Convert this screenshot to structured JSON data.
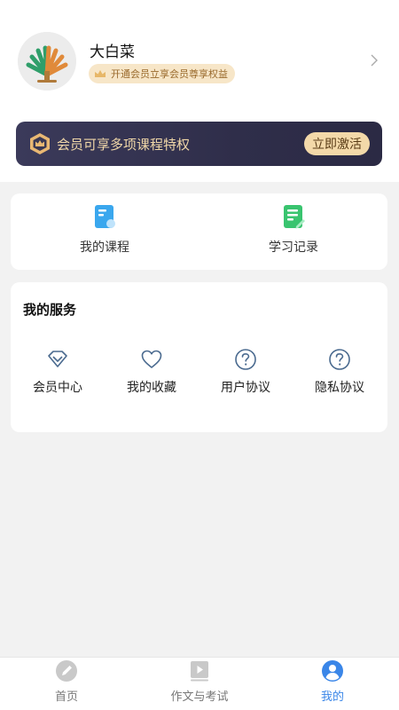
{
  "profile": {
    "username": "大白菜",
    "vip_pill_text": "开通会员立享会员尊享权益"
  },
  "banner": {
    "text": "会员可享多项课程特权",
    "button_label": "立即激活"
  },
  "quick": {
    "items": [
      {
        "label": "我的课程",
        "icon": "book-icon",
        "color": "#3aa7ee"
      },
      {
        "label": "学习记录",
        "icon": "note-icon",
        "color": "#39c46f"
      }
    ]
  },
  "services": {
    "title": "我的服务",
    "items": [
      {
        "label": "会员中心",
        "icon": "diamond-icon"
      },
      {
        "label": "我的收藏",
        "icon": "heart-icon"
      },
      {
        "label": "用户协议",
        "icon": "question-icon"
      },
      {
        "label": "隐私协议",
        "icon": "question-icon"
      }
    ]
  },
  "tabbar": {
    "items": [
      {
        "label": "首页",
        "icon": "pen-icon",
        "active": false
      },
      {
        "label": "作文与考试",
        "icon": "video-icon",
        "active": false
      },
      {
        "label": "我的",
        "icon": "user-icon",
        "active": true
      }
    ]
  },
  "colors": {
    "accent": "#3a86e8",
    "banner_bg": "#2f2e4a",
    "banner_gold": "#f0d7a8",
    "vip_pill_bg": "#f7e6c8",
    "page_bg": "#f2f2f2"
  }
}
